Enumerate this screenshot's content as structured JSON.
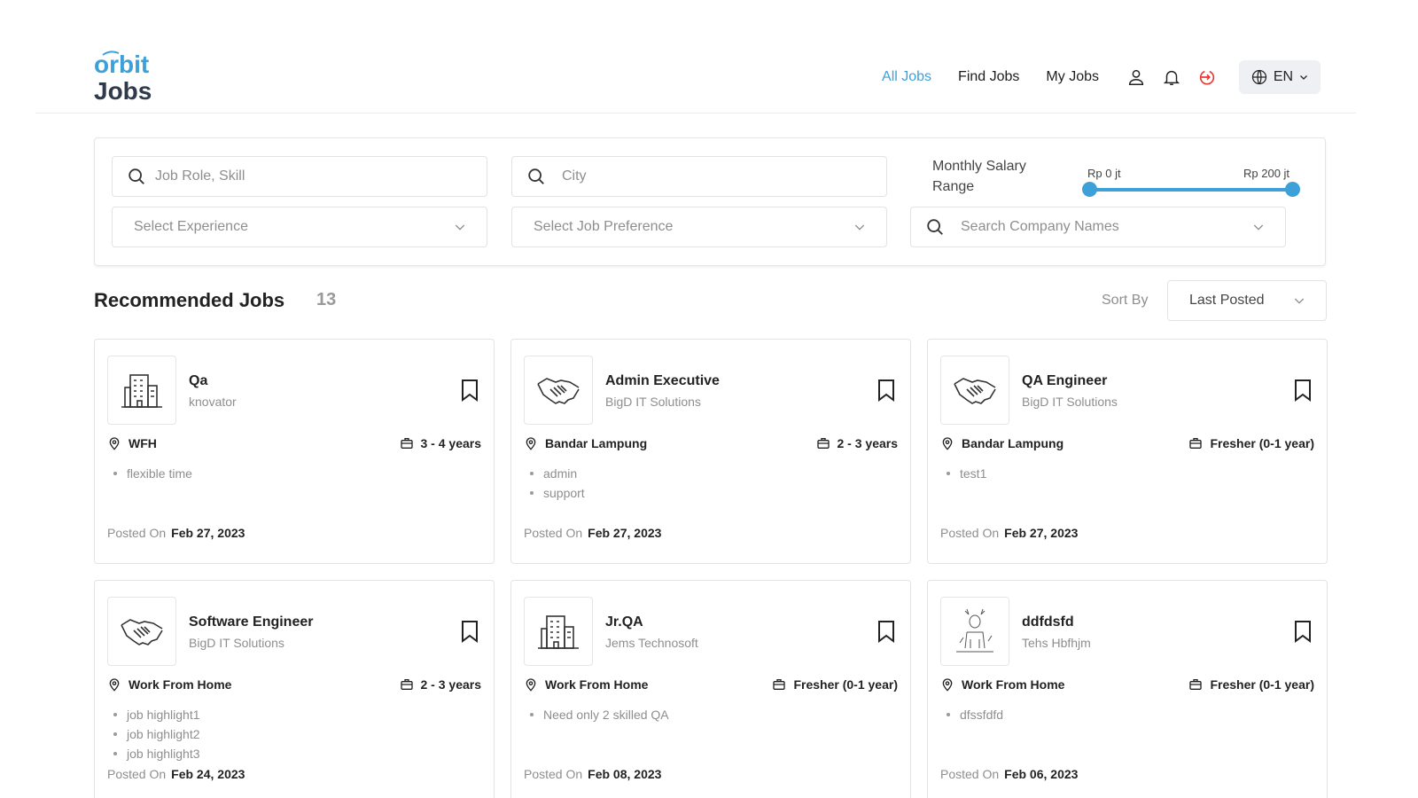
{
  "header": {
    "logo_text": "orbit Jobs",
    "nav": [
      "All Jobs",
      "Find Jobs",
      "My Jobs"
    ],
    "active_nav": "All Jobs",
    "language": "EN",
    "accent_color": "#3ea0d8",
    "logout_color": "#e53935"
  },
  "filters": {
    "role_placeholder": "Job Role, Skill",
    "city_placeholder": "City",
    "salary_label": "Monthly Salary Range",
    "salary_min": "Rp 0 jt",
    "salary_max": "Rp 200 jt",
    "experience_placeholder": "Select Experience",
    "preference_placeholder": "Select Job Preference",
    "company_placeholder": "Search Company Names"
  },
  "section": {
    "title": "Recommended Jobs",
    "count": "13",
    "sort_label": "Sort By",
    "sort_value": "Last Posted"
  },
  "jobs": [
    {
      "title": "Qa",
      "company": "knovator",
      "location": "WFH",
      "experience": "3 - 4 years",
      "highlights": [
        "flexible time"
      ],
      "posted_label": "Posted On",
      "posted_date": "Feb 27, 2023",
      "logo": "building-icon"
    },
    {
      "title": "Admin Executive",
      "company": "BigD IT Solutions",
      "location": "Bandar Lampung",
      "experience": "2 - 3 years",
      "highlights": [
        "admin",
        "support"
      ],
      "posted_label": "Posted On",
      "posted_date": "Feb 27, 2023",
      "logo": "handshake-icon"
    },
    {
      "title": "QA Engineer",
      "company": "BigD IT Solutions",
      "location": "Bandar Lampung",
      "experience": "Fresher (0-1 year)",
      "highlights": [
        "test1"
      ],
      "posted_label": "Posted On",
      "posted_date": "Feb 27, 2023",
      "logo": "handshake-icon"
    },
    {
      "title": "Software Engineer",
      "company": "BigD IT Solutions",
      "location": "Work From Home",
      "experience": "2 - 3 years",
      "highlights": [
        "job highlight1",
        "job highlight2",
        "job highlight3"
      ],
      "posted_label": "Posted On",
      "posted_date": "Feb 24, 2023",
      "logo": "handshake-icon"
    },
    {
      "title": "Jr.QA",
      "company": "Jems Technosoft",
      "location": "Work From Home",
      "experience": "Fresher (0-1 year)",
      "highlights": [
        "Need only 2 skilled QA"
      ],
      "posted_label": "Posted On",
      "posted_date": "Feb 08, 2023",
      "logo": "building-icon"
    },
    {
      "title": "ddfdsfd",
      "company": "Tehs Hbfhjm",
      "location": "Work From Home",
      "experience": "Fresher (0-1 year)",
      "highlights": [
        "dfssfdfd"
      ],
      "posted_label": "Posted On",
      "posted_date": "Feb 06, 2023",
      "logo": "deer-sketch-icon"
    }
  ]
}
